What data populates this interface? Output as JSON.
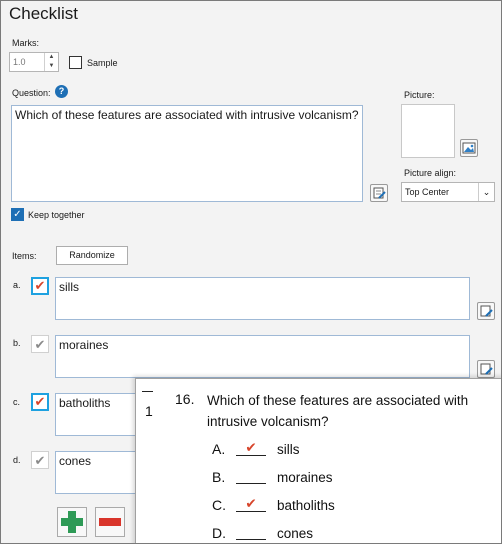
{
  "title": "Checklist",
  "marks": {
    "label": "Marks:",
    "value": "1.0",
    "sample_label": "Sample"
  },
  "question": {
    "label": "Question:",
    "text": "Which of these features are associated with intrusive volcanism?"
  },
  "picture": {
    "label": "Picture:",
    "align_label": "Picture align:",
    "align_value": "Top Center"
  },
  "keep_together": "Keep together",
  "items_label": "Items:",
  "randomize": "Randomize",
  "items": [
    {
      "letter": "a.",
      "text": "sills",
      "checked": true
    },
    {
      "letter": "b.",
      "text": "moraines",
      "checked": false
    },
    {
      "letter": "c.",
      "text": "batholiths",
      "checked": true
    },
    {
      "letter": "d.",
      "text": "cones",
      "checked": false
    }
  ],
  "preview": {
    "score": "1",
    "number": "16.",
    "question_line1": "Which of these features are associated with",
    "question_line2": "intrusive volcanism?",
    "options": [
      {
        "letter": "A.",
        "text": "sills",
        "checked": true
      },
      {
        "letter": "B.",
        "text": "moraines",
        "checked": false
      },
      {
        "letter": "C.",
        "text": "batholiths",
        "checked": true
      },
      {
        "letter": "D.",
        "text": "cones",
        "checked": false
      }
    ]
  },
  "icons": {
    "help": "help-icon",
    "check": "checkmark-icon",
    "edit": "edit-icon",
    "picture": "picture-icon",
    "add": "plus-icon",
    "remove": "minus-icon"
  },
  "colors": {
    "accent": "#1e6fb5",
    "check_red": "#d7452b",
    "add_green": "#2e9a56",
    "remove_red": "#d9352b"
  }
}
